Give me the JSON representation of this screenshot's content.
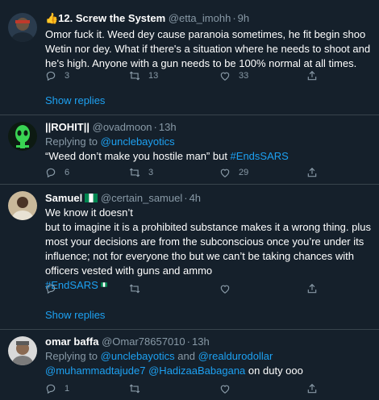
{
  "tweets": [
    {
      "name": "👍12. Screw the System",
      "handle": "@etta_imohh",
      "time": "9h",
      "text": "Omor fuck it. Weed dey cause paranoia sometimes, he fit begin shoo Wetin nor dey. What if there's a situation where he needs to shoot and he's high. Anyone with a gun needs to be 100% normal at all times.",
      "replies": "3",
      "retweets": "13",
      "likes": "33"
    },
    {
      "name": "||ROHIT||",
      "handle": "@ovadmoon",
      "time": "13h",
      "replying_label": "Replying to",
      "replying_to": "@unclebayotics",
      "text": "“Weed don’t make you hostile man”  but ",
      "hashtag": "#EndsSARS",
      "replies": "6",
      "retweets": "3",
      "likes": "29"
    },
    {
      "name": "Samuel",
      "handle": "@certain_samuel",
      "time": "4h",
      "line1": "We know it doesn’t",
      "line2": "but to imagine it is a prohibited substance makes it a wrong thing.  plus most your decisions are from the subconscious once you’re under its influence; not for everyone tho but we can’t be taking chances with officers vested with guns and ammo",
      "hashtag": "#EndSARS"
    },
    {
      "name": "omar baffa",
      "handle": "@Omar78657010",
      "time": "13h",
      "replying_label": "Replying to",
      "replying_to_1": "@unclebayotics",
      "and_label": "and",
      "replying_to_2": "@realdurodollar",
      "mention1": "@muhammadtajude7",
      "mention2": "@HadizaaBabagana",
      "text": "on duty ooo",
      "replies": "1"
    }
  ],
  "show_replies_label": "Show replies",
  "icons": [
    "reply-icon",
    "retweet-icon",
    "like-icon",
    "share-icon",
    "thumbs-up-emoji",
    "nigeria-flag-emoji"
  ],
  "colors": {
    "background": "#15202b",
    "link": "#1da1f2",
    "muted": "#8899a6",
    "divider": "#38444d"
  }
}
